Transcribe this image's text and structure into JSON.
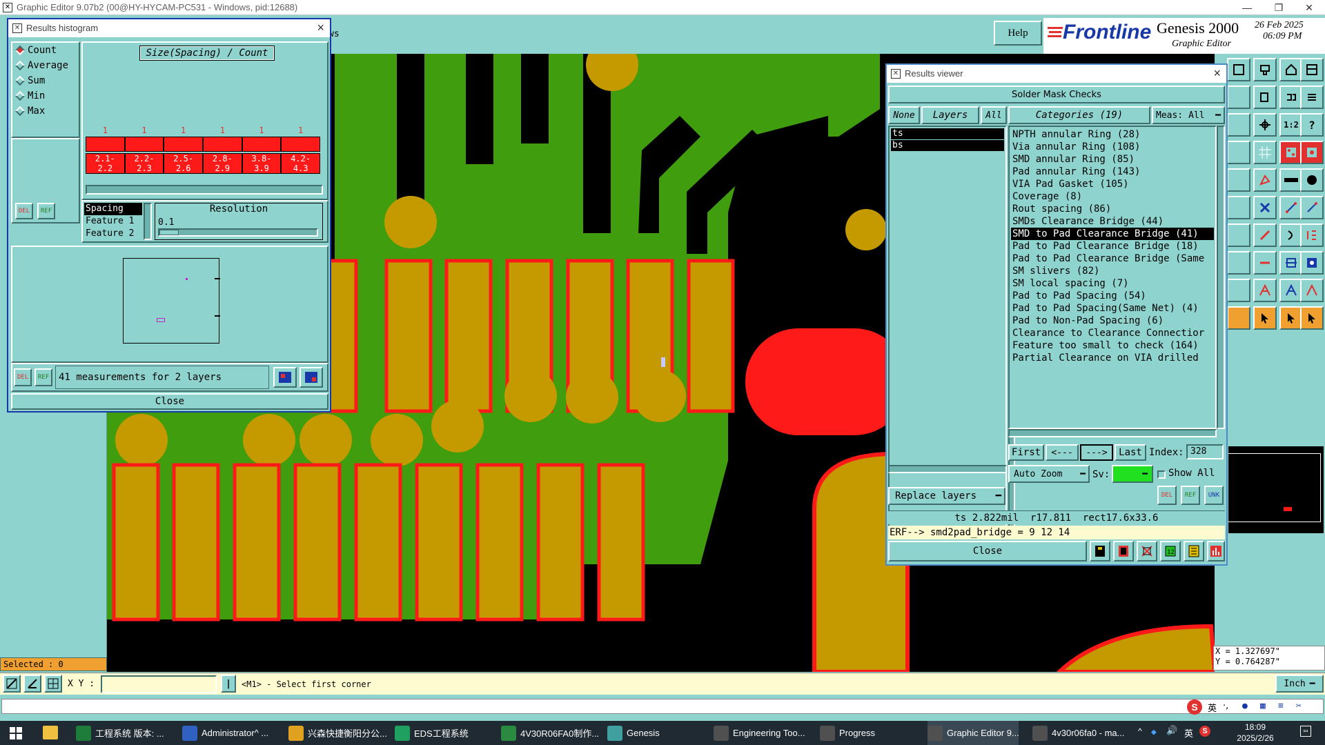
{
  "window": {
    "title": "Graphic Editor 9.07b2 (00@HY-HYCAM-PC531 - Windows, pid:12688)",
    "minimize_glyph": "—",
    "restore_glyph": "❐",
    "close_glyph": "✕"
  },
  "header": {
    "partial_menu": "ws",
    "help": "Help",
    "brand": "Frontline",
    "product": "Genesis 2000",
    "subtitle": "Graphic Editor",
    "date": "26 Feb 2025",
    "time": "06:09 PM"
  },
  "histogram": {
    "title": "Results histogram",
    "modes": [
      "Count",
      "Average",
      "Sum",
      "Min",
      "Max"
    ],
    "selected_mode": "Count",
    "chart_title": "Size(Spacing) / Count",
    "bins": [
      {
        "count": "1",
        "label_top": "2.1-",
        "label_bottom": "2.2"
      },
      {
        "count": "1",
        "label_top": "2.2-",
        "label_bottom": "2.3"
      },
      {
        "count": "1",
        "label_top": "2.5-",
        "label_bottom": "2.6"
      },
      {
        "count": "1",
        "label_top": "2.8-",
        "label_bottom": "2.9"
      },
      {
        "count": "1",
        "label_top": "3.8-",
        "label_bottom": "3.9"
      },
      {
        "count": "1",
        "label_top": "4.2-",
        "label_bottom": "4.3"
      }
    ],
    "field_list": [
      "Spacing",
      "Feature 1",
      "Feature 2"
    ],
    "resolution_label": "Resolution",
    "resolution_value": "0.1",
    "summary": "41 measurements for 2 layers",
    "del": "DEL",
    "ref": "REF",
    "close": "Close"
  },
  "viewer": {
    "title": "Results viewer",
    "header": "Solder Mask Checks",
    "tabs": {
      "none": "None",
      "layers": "Layers",
      "all": "All"
    },
    "categories_label": "Categories (19)",
    "meas_label": "Meas:",
    "meas_value": "All",
    "layers": [
      "ts",
      "bs"
    ],
    "categories": [
      "NPTH annular Ring (28)",
      "Via annular Ring (108)",
      "SMD annular Ring (85)",
      "Pad annular Ring (143)",
      "VIA Pad Gasket (105)",
      "Coverage (8)",
      "Rout spacing (86)",
      "SMDs Clearance Bridge (44)",
      "SMD to Pad Clearance Bridge (41)",
      "Pad to Pad Clearance Bridge (18)",
      "Pad to Pad Clearance Bridge (Same",
      "SM slivers (82)",
      "SM local spacing (7)",
      "Pad to Pad Spacing (54)",
      "Pad to Pad Spacing(Same Net) (4)",
      "Pad to Non-Pad Spacing (6)",
      "Clearance to Clearance Connectior",
      "Feature too small to check (164)",
      "Partial Clearance on VIA drilled"
    ],
    "selected_category": "SMD to Pad Clearance Bridge (41)",
    "nav": {
      "first": "First",
      "prev": "<---",
      "next": "--->",
      "last": "Last",
      "index_label": "Index:",
      "index_value": "328"
    },
    "auto_zoom": "Auto Zoom",
    "sv_label": "Sv:",
    "show_all": "Show All",
    "replace_layers": "Replace layers",
    "del": "DEL",
    "ref": "REF",
    "unk": "UNK",
    "measurement": "ts 2.822mil  r17.811  rect17.6x33.6",
    "erf": "ERF--> smd2pad_bridge = 9 12 14",
    "close": "Close"
  },
  "statusbar": {
    "selected": "Selected : 0",
    "xy_label": "X Y :",
    "xy_value": "",
    "prompt": "<M1> - Select first corner",
    "units": "Inch",
    "coord_x": "X = 1.327697\"",
    "coord_y": "Y = 0.764287\""
  },
  "taskbar": {
    "items": [
      {
        "label": "工程系统  版本: ...",
        "color": "#1e7d3a"
      },
      {
        "label": "Administrator^ ...",
        "color": "#3060c0"
      },
      {
        "label": "兴森快捷衡阳分公...",
        "color": "#e0a020"
      },
      {
        "label": "EDS工程系统",
        "color": "#20a060"
      },
      {
        "label": "4V30R06FA0制作...",
        "color": "#2a8a40"
      },
      {
        "label": "Genesis",
        "color": "#40a0a0"
      },
      {
        "label": "Engineering Too...",
        "color": "#505050"
      },
      {
        "label": "Progress",
        "color": "#505050"
      },
      {
        "label": "Graphic Editor 9...",
        "color": "#505050"
      },
      {
        "label": "4v30r06fa0 - ma...",
        "color": "#505050"
      }
    ],
    "tray_lang": "英",
    "tray_s": "S",
    "clock_time": "18:09",
    "clock_date": "2025/2/26",
    "tray_up": "⌃",
    "tray_speaker": "🔊",
    "tray_ime": "英"
  },
  "ime_bar": {
    "lang": "英",
    "dot": "·,",
    "logo": "S"
  },
  "colors": {
    "panel": "#8fd3cf",
    "copper": "#c49a00",
    "mask": "#3f9d0e",
    "bridge": "#ff1a1a",
    "canvas": "#000000"
  }
}
